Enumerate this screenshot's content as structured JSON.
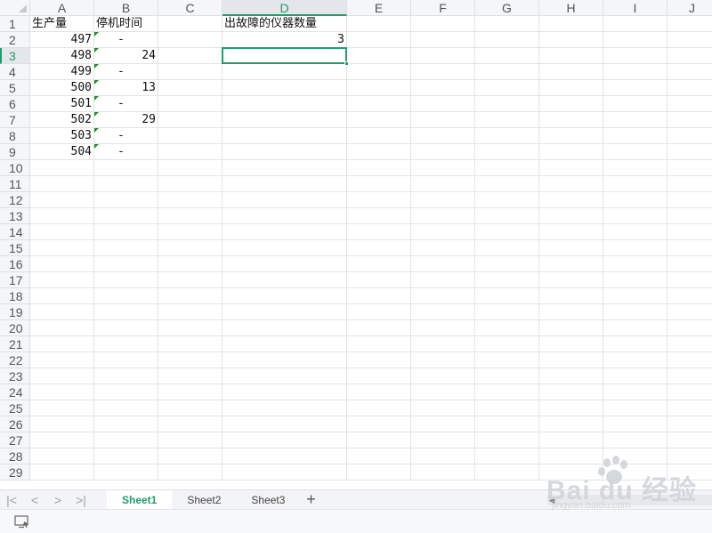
{
  "columns": [
    "A",
    "B",
    "C",
    "D",
    "E",
    "F",
    "G",
    "H",
    "I",
    "J"
  ],
  "active_column": "D",
  "active_row": 3,
  "rows": [
    {
      "num": "1",
      "a": "生产量",
      "b": "停机时间",
      "d": "出故障的仪器数量"
    },
    {
      "num": "2",
      "a": "497",
      "b": "-",
      "d": "3"
    },
    {
      "num": "3",
      "a": "498",
      "b": "24",
      "d": ""
    },
    {
      "num": "4",
      "a": "499",
      "b": "-",
      "d": ""
    },
    {
      "num": "5",
      "a": "500",
      "b": "13",
      "d": ""
    },
    {
      "num": "6",
      "a": "501",
      "b": "-",
      "d": ""
    },
    {
      "num": "7",
      "a": "502",
      "b": "29",
      "d": ""
    },
    {
      "num": "8",
      "a": "503",
      "b": "-",
      "d": ""
    },
    {
      "num": "9",
      "a": "504",
      "b": "-",
      "d": ""
    },
    {
      "num": "10"
    },
    {
      "num": "11"
    },
    {
      "num": "12"
    },
    {
      "num": "13"
    },
    {
      "num": "14"
    },
    {
      "num": "15"
    },
    {
      "num": "16"
    },
    {
      "num": "17"
    },
    {
      "num": "18"
    },
    {
      "num": "19"
    },
    {
      "num": "20"
    },
    {
      "num": "21"
    },
    {
      "num": "22"
    },
    {
      "num": "23"
    },
    {
      "num": "24"
    },
    {
      "num": "25"
    },
    {
      "num": "26"
    },
    {
      "num": "27"
    },
    {
      "num": "28"
    },
    {
      "num": "29"
    }
  ],
  "sheet_tabs": [
    "Sheet1",
    "Sheet2",
    "Sheet3"
  ],
  "active_sheet": "Sheet1",
  "nav_icons": [
    "first-sheet-icon",
    "prev-sheet-icon",
    "next-sheet-icon",
    "last-sheet-icon"
  ],
  "add_sheet_label": "+",
  "watermark": {
    "main": "Bai du 经验",
    "sub": "jingyan.baidu.com"
  },
  "colors": {
    "accent": "#1e9e6a",
    "gridline": "#e1e4e8",
    "header_bg": "#f5f6f7",
    "flag": "#1e8f3b"
  }
}
